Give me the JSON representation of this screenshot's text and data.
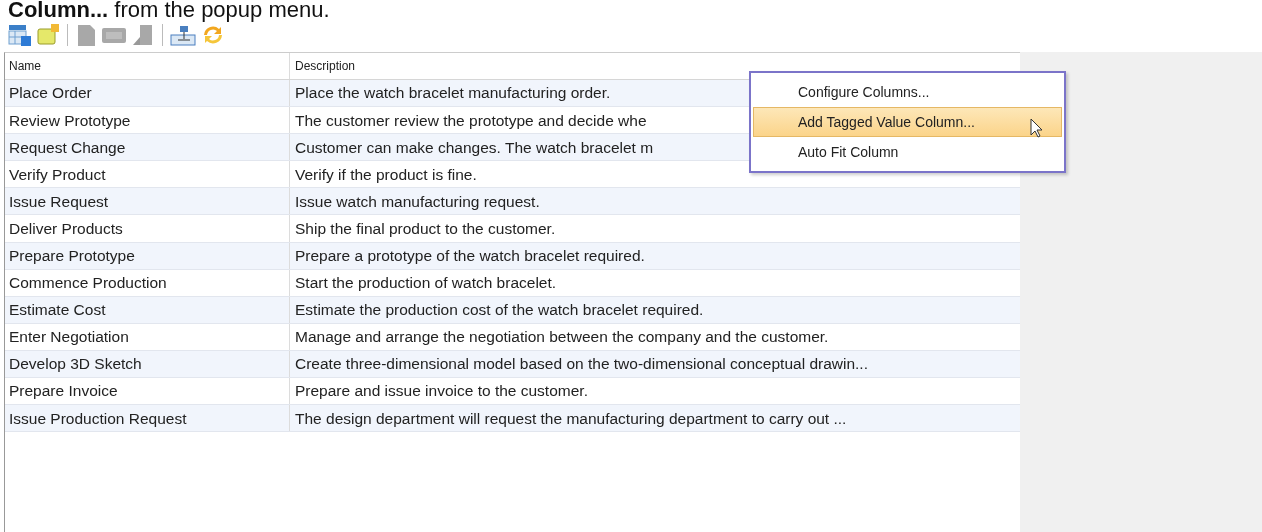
{
  "caption": "**Column...** from the popup menu.",
  "table": {
    "columns": [
      "Name",
      "Description"
    ],
    "rows": [
      {
        "name": "Place Order",
        "description": "Place the watch bracelet manufacturing order."
      },
      {
        "name": "Review Prototype",
        "description": "The customer review the prototype and decide whe"
      },
      {
        "name": "Request Change",
        "description": "Customer can make changes. The watch bracelet m"
      },
      {
        "name": "Verify Product",
        "description": "Verify if the product is fine."
      },
      {
        "name": "Issue Request",
        "description": "Issue watch manufacturing request."
      },
      {
        "name": "Deliver Products",
        "description": "Ship the final product to the customer."
      },
      {
        "name": "Prepare Prototype",
        "description": "Prepare a prototype of the watch bracelet required."
      },
      {
        "name": "Commence Production",
        "description": "Start the production of watch bracelet."
      },
      {
        "name": "Estimate Cost",
        "description": "Estimate the production cost of the watch bracelet required."
      },
      {
        "name": "Enter Negotiation",
        "description": "Manage and arrange the negotiation between the company and the customer."
      },
      {
        "name": "Develop 3D Sketch",
        "description": "Create three-dimensional model based on the two-dimensional conceptual drawin..."
      },
      {
        "name": "Prepare Invoice",
        "description": "Prepare and issue invoice to the customer."
      },
      {
        "name": "Issue Production Request",
        "description": "The design department will request the manufacturing department to carry out ..."
      }
    ]
  },
  "context_menu": {
    "items": [
      {
        "label": "Configure Columns...",
        "selected": false
      },
      {
        "label": "Add Tagged Value Column...",
        "selected": true
      },
      {
        "label": "Auto Fit Column",
        "selected": false
      }
    ]
  }
}
